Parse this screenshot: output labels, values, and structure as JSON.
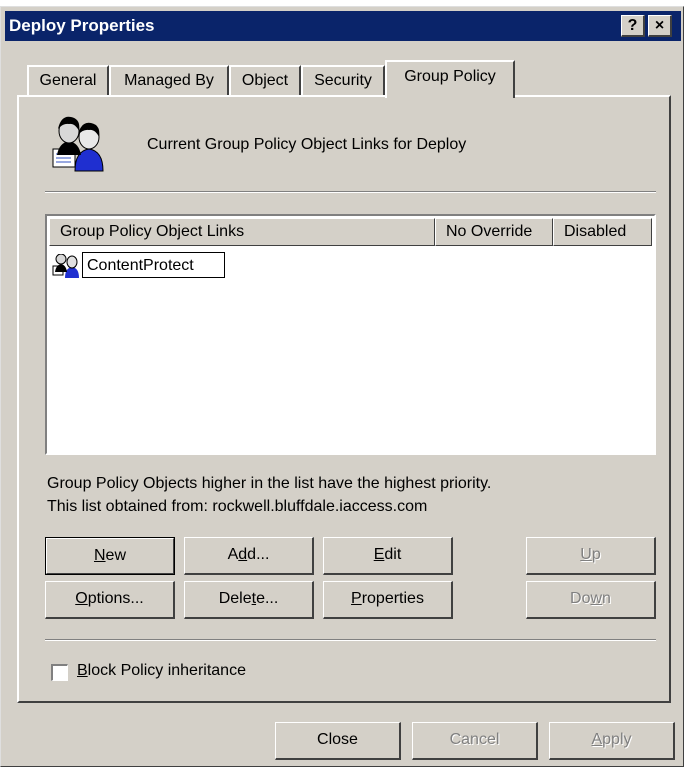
{
  "window": {
    "title": "Deploy Properties",
    "help_btn": "?",
    "close_btn": "×"
  },
  "tabs": [
    {
      "label": "General"
    },
    {
      "label": "Managed By"
    },
    {
      "label": "Object"
    },
    {
      "label": "Security"
    },
    {
      "label": "Group Policy",
      "active": true
    }
  ],
  "header_text": "Current Group Policy Object Links for Deploy",
  "list": {
    "columns": [
      "Group Policy Object Links",
      "No Override",
      "Disabled"
    ],
    "items": [
      {
        "name": "ContentProtect",
        "no_override": "",
        "disabled": ""
      }
    ]
  },
  "info": {
    "line1": "Group Policy Objects higher in the list have the highest priority.",
    "line2": "This list obtained from: rockwell.bluffdale.iaccess.com"
  },
  "buttons": {
    "new_pre": "",
    "new_u": "N",
    "new_post": "ew",
    "add_pre": "A",
    "add_u": "d",
    "add_post": "d...",
    "edit_pre": "",
    "edit_u": "E",
    "edit_post": "dit",
    "up_pre": "",
    "up_u": "U",
    "up_post": "p",
    "options_pre": "",
    "options_u": "O",
    "options_post": "ptions...",
    "delete_pre": "Dele",
    "delete_u": "t",
    "delete_post": "e...",
    "properties_pre": "",
    "properties_u": "P",
    "properties_post": "roperties",
    "down_pre": "Do",
    "down_u": "w",
    "down_post": "n"
  },
  "checkbox": {
    "pre": "",
    "u": "B",
    "post": "lock Policy inheritance",
    "checked": false
  },
  "dialog_buttons": {
    "close": "Close",
    "cancel": "Cancel",
    "apply_pre": "",
    "apply_u": "A",
    "apply_post": "pply"
  }
}
